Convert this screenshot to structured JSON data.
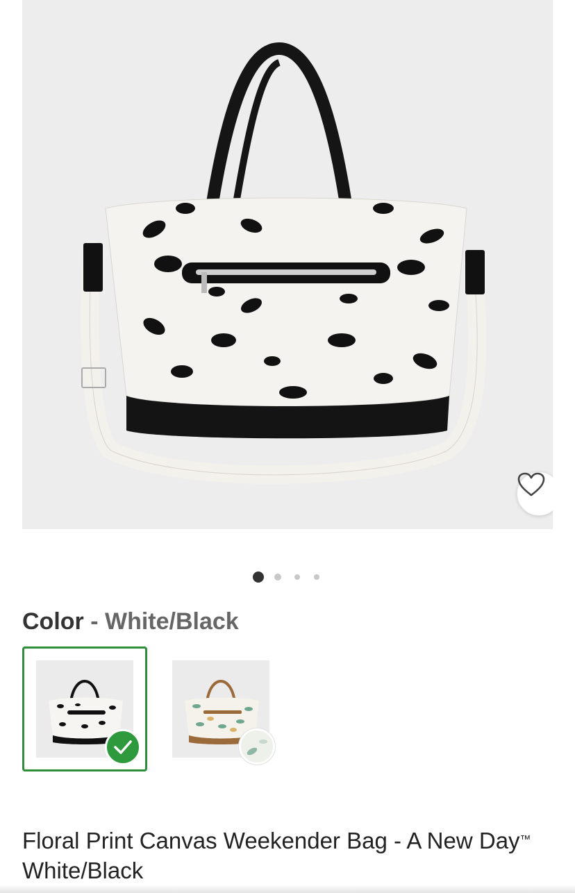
{
  "product": {
    "title_main": "Floral Print Canvas Weekender Bag - A New Day",
    "title_trademark": "™",
    "title_variant": " White/Black"
  },
  "gallery": {
    "image_count": 4,
    "active_index": 0,
    "favorite_icon": "heart-outline-icon"
  },
  "color_picker": {
    "label": "Color",
    "separator": " - ",
    "selected_value": "White/Black",
    "options": [
      {
        "name": "White/Black",
        "selected": true,
        "icon": "check-icon",
        "accent": "#2f9a3d"
      },
      {
        "name": "Floral Green/Tan",
        "selected": false
      }
    ]
  },
  "colors": {
    "selected_border": "#2f8e3c",
    "check_bg": "#2f9a3d",
    "image_bg": "#ededed"
  }
}
